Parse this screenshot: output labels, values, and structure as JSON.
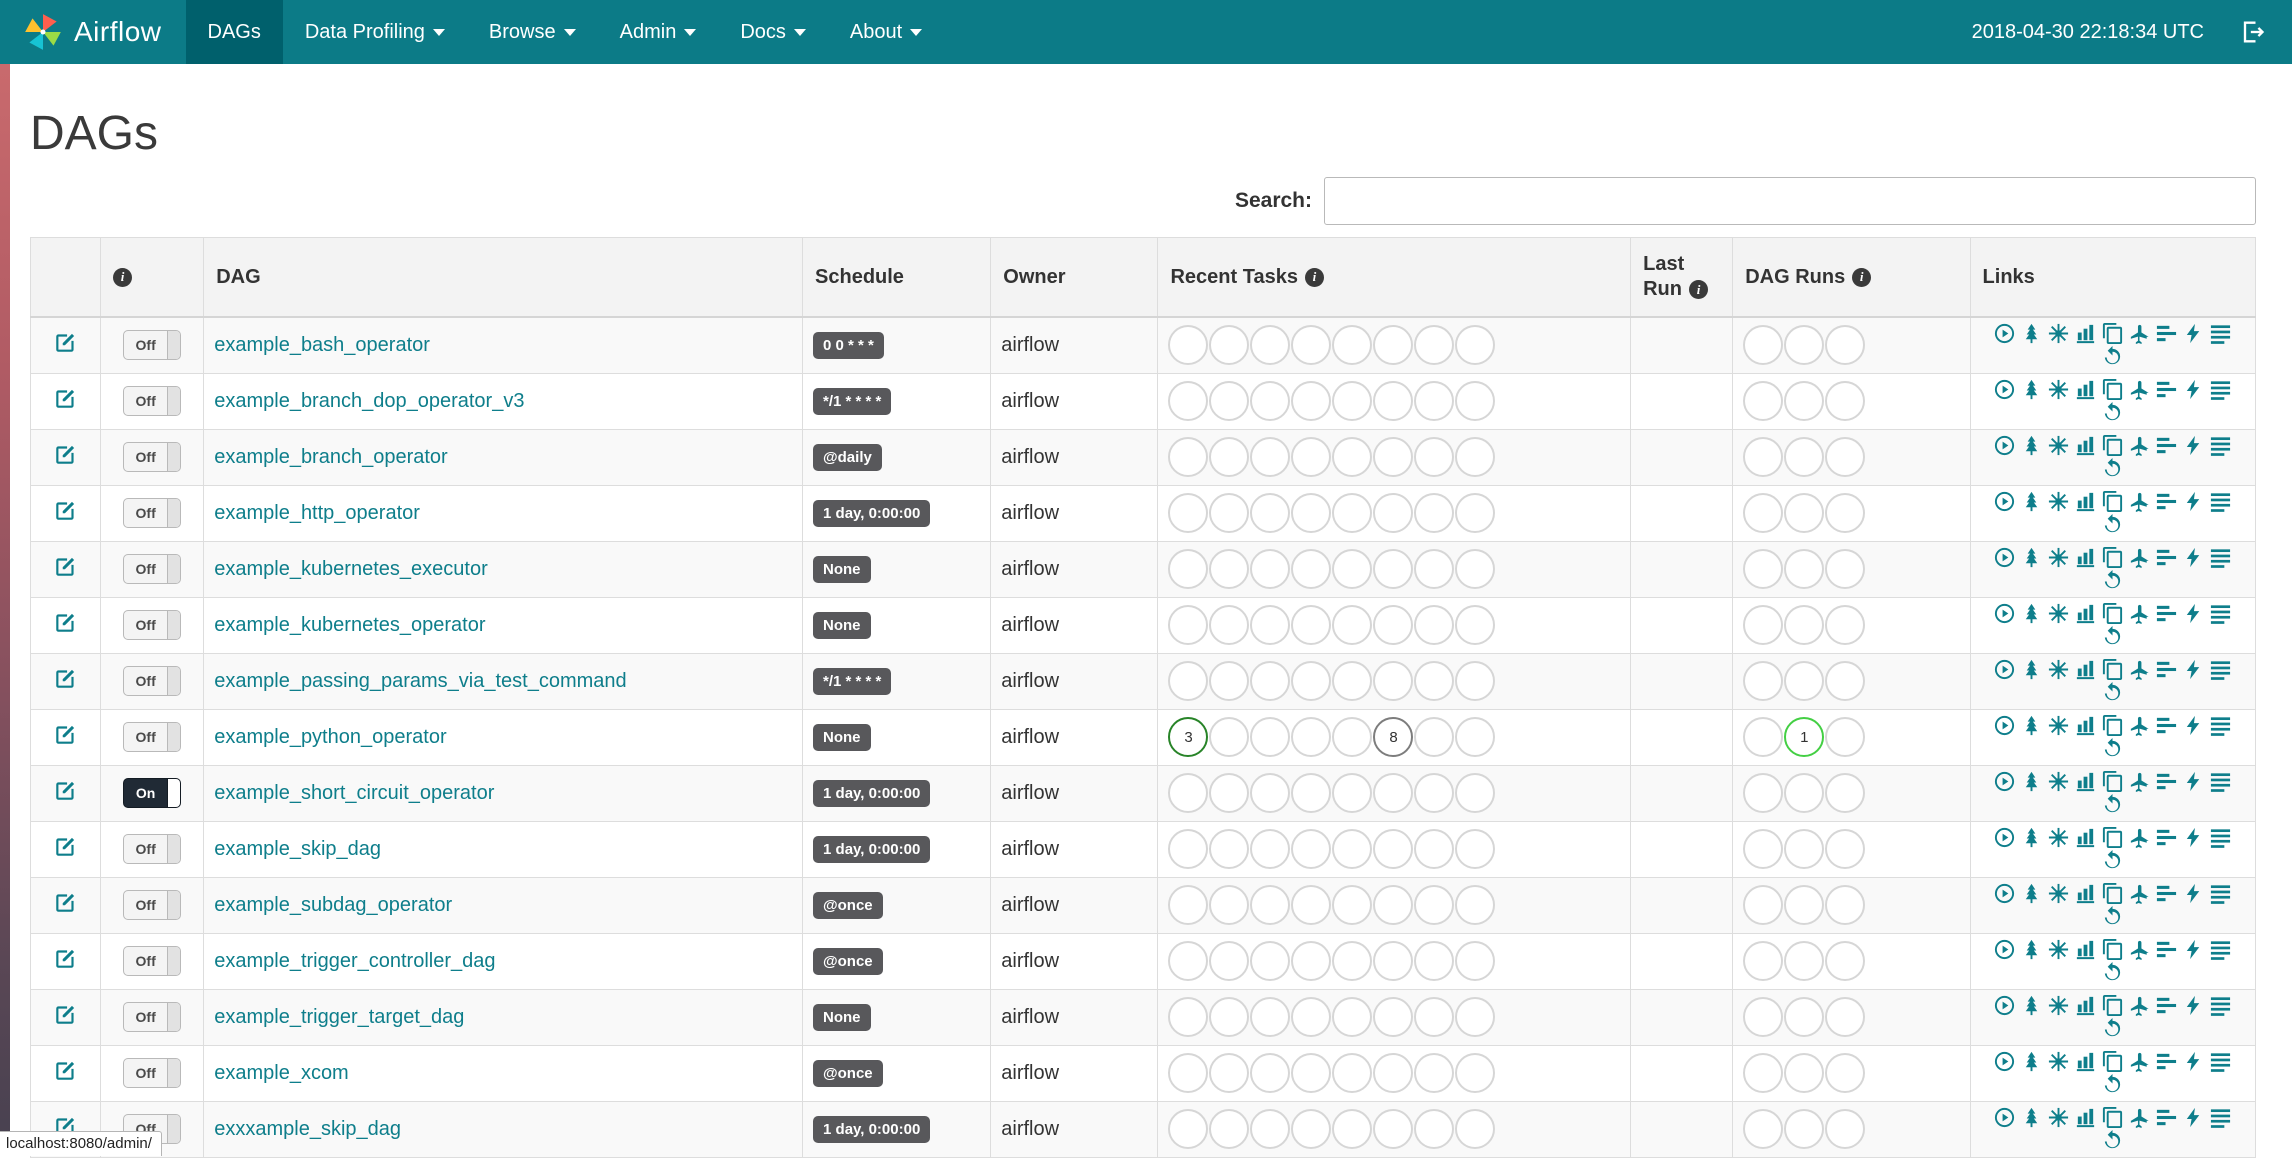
{
  "colors": {
    "navbar_bg": "#0c7b87",
    "navbar_active_bg": "#00606c",
    "accent": "#0e7e8b",
    "badge_bg": "#58585b",
    "states": {
      "success": "#288428",
      "running": "#44cf44",
      "queued": "#7d7d7d"
    }
  },
  "icons": {
    "info": "i"
  },
  "navbar": {
    "brand": "Airflow",
    "items": [
      {
        "label": "DAGs",
        "active": true,
        "dropdown": false
      },
      {
        "label": "Data Profiling",
        "active": false,
        "dropdown": true
      },
      {
        "label": "Browse",
        "active": false,
        "dropdown": true
      },
      {
        "label": "Admin",
        "active": false,
        "dropdown": true
      },
      {
        "label": "Docs",
        "active": false,
        "dropdown": true
      },
      {
        "label": "About",
        "active": false,
        "dropdown": true
      }
    ],
    "clock": "2018-04-30 22:18:34 UTC"
  },
  "page": {
    "title": "DAGs",
    "search_label": "Search:",
    "search_value": ""
  },
  "status_bar": {
    "text": "localhost:8080/admin/"
  },
  "table": {
    "headers": {
      "dag": "DAG",
      "schedule": "Schedule",
      "owner": "Owner",
      "recent_tasks": "Recent Tasks",
      "last_run": "Last Run",
      "dag_runs": "DAG Runs",
      "links": "Links"
    },
    "recent_task_slots": 8,
    "dag_run_slots": 3,
    "links": [
      "trigger-dag",
      "tree-view",
      "graph-view",
      "task-duration",
      "task-tries",
      "landing-times",
      "gantt",
      "code-view",
      "logs",
      "refresh"
    ],
    "rows": [
      {
        "dag_id": "example_bash_operator",
        "schedule": "0 0 * * *",
        "owner": "airflow",
        "toggle": "Off",
        "recent_tasks": [],
        "dag_runs": [],
        "last_run": ""
      },
      {
        "dag_id": "example_branch_dop_operator_v3",
        "schedule": "*/1 * * * *",
        "owner": "airflow",
        "toggle": "Off",
        "recent_tasks": [],
        "dag_runs": [],
        "last_run": ""
      },
      {
        "dag_id": "example_branch_operator",
        "schedule": "@daily",
        "owner": "airflow",
        "toggle": "Off",
        "recent_tasks": [],
        "dag_runs": [],
        "last_run": ""
      },
      {
        "dag_id": "example_http_operator",
        "schedule": "1 day, 0:00:00",
        "owner": "airflow",
        "toggle": "Off",
        "recent_tasks": [],
        "dag_runs": [],
        "last_run": ""
      },
      {
        "dag_id": "example_kubernetes_executor",
        "schedule": "None",
        "owner": "airflow",
        "toggle": "Off",
        "recent_tasks": [],
        "dag_runs": [],
        "last_run": ""
      },
      {
        "dag_id": "example_kubernetes_operator",
        "schedule": "None",
        "owner": "airflow",
        "toggle": "Off",
        "recent_tasks": [],
        "dag_runs": [],
        "last_run": ""
      },
      {
        "dag_id": "example_passing_params_via_test_command",
        "schedule": "*/1 * * * *",
        "owner": "airflow",
        "toggle": "Off",
        "recent_tasks": [],
        "dag_runs": [],
        "last_run": ""
      },
      {
        "dag_id": "example_python_operator",
        "schedule": "None",
        "owner": "airflow",
        "toggle": "Off",
        "recent_tasks": [
          {
            "pos": 0,
            "count": 3,
            "state": "success"
          },
          {
            "pos": 5,
            "count": 8,
            "state": "queued"
          }
        ],
        "dag_runs": [
          {
            "pos": 1,
            "count": 1,
            "state": "running"
          }
        ],
        "last_run": ""
      },
      {
        "dag_id": "example_short_circuit_operator",
        "schedule": "1 day, 0:00:00",
        "owner": "airflow",
        "toggle": "On",
        "recent_tasks": [],
        "dag_runs": [],
        "last_run": ""
      },
      {
        "dag_id": "example_skip_dag",
        "schedule": "1 day, 0:00:00",
        "owner": "airflow",
        "toggle": "Off",
        "recent_tasks": [],
        "dag_runs": [],
        "last_run": ""
      },
      {
        "dag_id": "example_subdag_operator",
        "schedule": "@once",
        "owner": "airflow",
        "toggle": "Off",
        "recent_tasks": [],
        "dag_runs": [],
        "last_run": ""
      },
      {
        "dag_id": "example_trigger_controller_dag",
        "schedule": "@once",
        "owner": "airflow",
        "toggle": "Off",
        "recent_tasks": [],
        "dag_runs": [],
        "last_run": ""
      },
      {
        "dag_id": "example_trigger_target_dag",
        "schedule": "None",
        "owner": "airflow",
        "toggle": "Off",
        "recent_tasks": [],
        "dag_runs": [],
        "last_run": ""
      },
      {
        "dag_id": "example_xcom",
        "schedule": "@once",
        "owner": "airflow",
        "toggle": "Off",
        "recent_tasks": [],
        "dag_runs": [],
        "last_run": ""
      },
      {
        "dag_id": "exxxample_skip_dag",
        "schedule": "1 day, 0:00:00",
        "owner": "airflow",
        "toggle": "Off",
        "recent_tasks": [],
        "dag_runs": [],
        "last_run": ""
      }
    ]
  }
}
